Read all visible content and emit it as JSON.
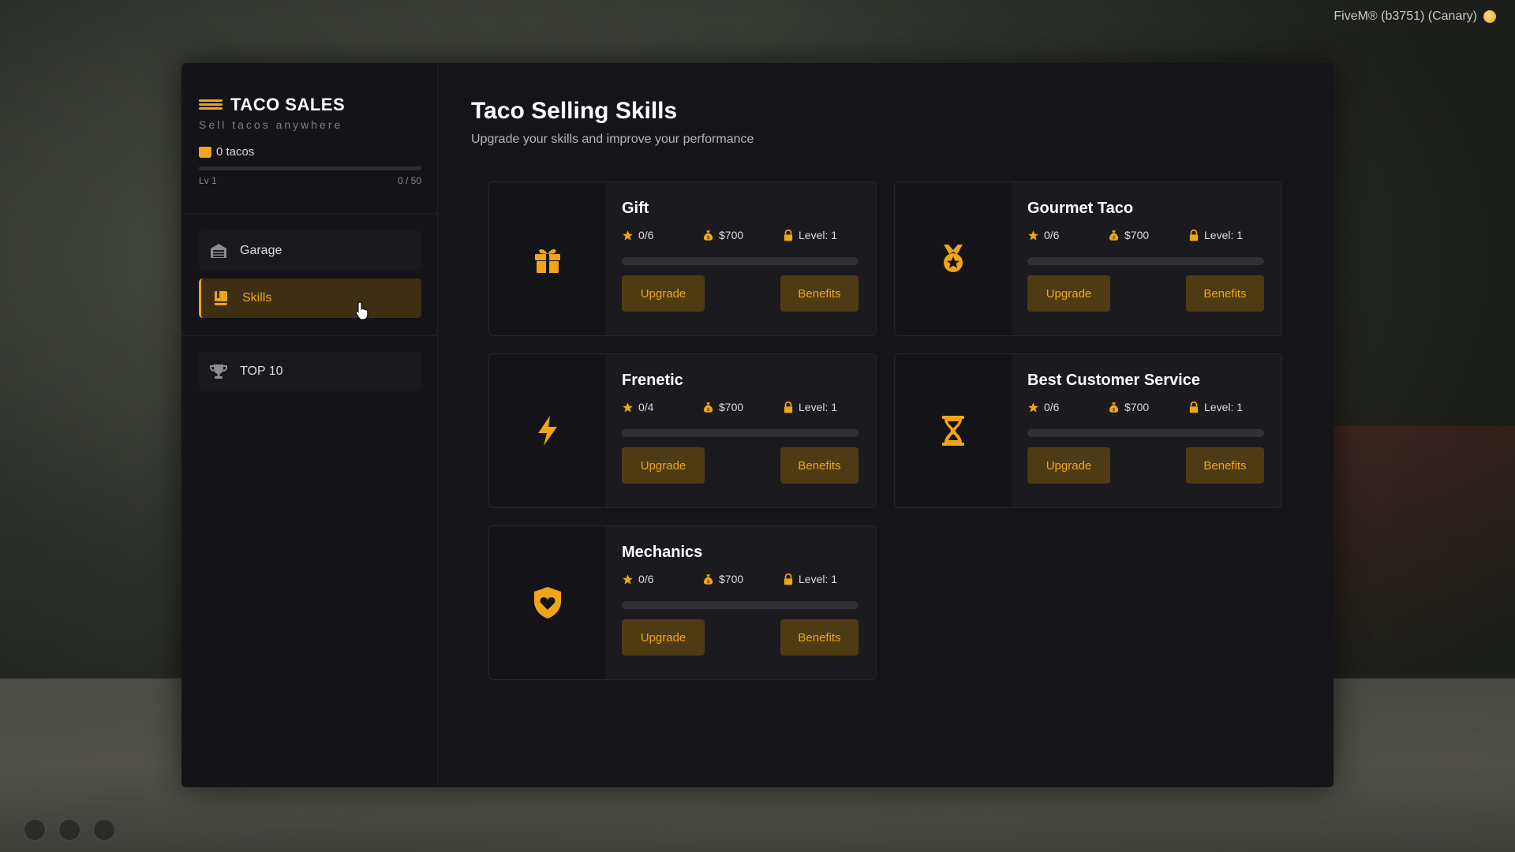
{
  "overlay": {
    "client_label": "FiveM® (b3751) (Canary)"
  },
  "sidebar": {
    "brand_title": "TACO SALES",
    "brand_subtitle": "Sell tacos anywhere",
    "tacos_label": "0 tacos",
    "level_label": "Lv 1",
    "xp_label": "0 / 50",
    "xp_progress": 0,
    "nav": [
      {
        "label": "Garage",
        "icon": "garage-icon",
        "active": false
      },
      {
        "label": "Skills",
        "icon": "skills-book-icon",
        "active": true
      },
      {
        "label": "TOP 10",
        "icon": "trophy-icon",
        "active": false
      }
    ]
  },
  "main": {
    "title": "Taco Selling Skills",
    "subtitle": "Upgrade your skills and improve your performance",
    "upgrade_label": "Upgrade",
    "benefits_label": "Benefits",
    "skills": [
      {
        "name": "Gift",
        "icon": "gift-icon",
        "progress": "0/6",
        "price": "$700",
        "level": "Level: 1",
        "fill": 0
      },
      {
        "name": "Gourmet Taco",
        "icon": "medal-icon",
        "progress": "0/6",
        "price": "$700",
        "level": "Level: 1",
        "fill": 0
      },
      {
        "name": "Frenetic",
        "icon": "lightning-icon",
        "progress": "0/4",
        "price": "$700",
        "level": "Level: 1",
        "fill": 0
      },
      {
        "name": "Best Customer Service",
        "icon": "hourglass-icon",
        "progress": "0/6",
        "price": "$700",
        "level": "Level: 1",
        "fill": 0
      },
      {
        "name": "Mechanics",
        "icon": "shield-heart-icon",
        "progress": "0/6",
        "price": "$700",
        "level": "Level: 1",
        "fill": 0
      }
    ]
  },
  "colors": {
    "accent": "#f0a417",
    "panel": "#151519",
    "card": "#1a1a1f",
    "button": "#4e3b14"
  }
}
